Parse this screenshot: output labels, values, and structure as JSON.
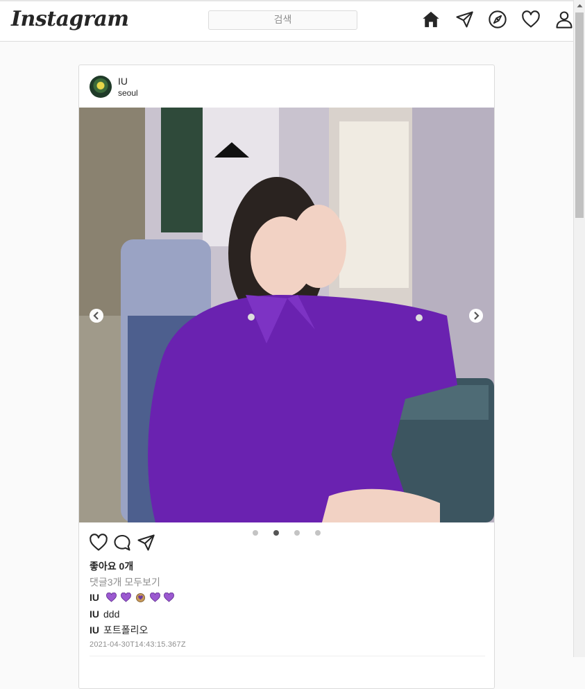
{
  "header": {
    "logo": "Instagram",
    "search_placeholder": "검색",
    "icons": [
      "home-icon",
      "direct-message-icon",
      "explore-compass-icon",
      "activity-heart-icon",
      "profile-icon"
    ]
  },
  "post": {
    "username": "IU",
    "location": "seoul",
    "image_alt": "IU wearing a purple satin blouse seated in a booth",
    "carousel": {
      "count": 4,
      "active_index": 1
    },
    "likes_text": "좋아요 0개",
    "view_comments_text": "댓글3개 모두보기",
    "comments": [
      {
        "user": "IU",
        "text": "",
        "emoji": [
          "purple-heart",
          "purple-heart",
          "heart-hands",
          "purple-heart",
          "purple-heart"
        ]
      },
      {
        "user": "IU",
        "text": "ddd"
      },
      {
        "user": "IU",
        "text": "포트폴리오"
      }
    ],
    "timestamp": "2021-04-30T14:43:15.367Z"
  },
  "colors": {
    "border": "#dbdbdb",
    "background": "#fafafa",
    "text": "#262626",
    "muted": "#8e8e8e",
    "emoji_purple": "#9b59d0"
  }
}
